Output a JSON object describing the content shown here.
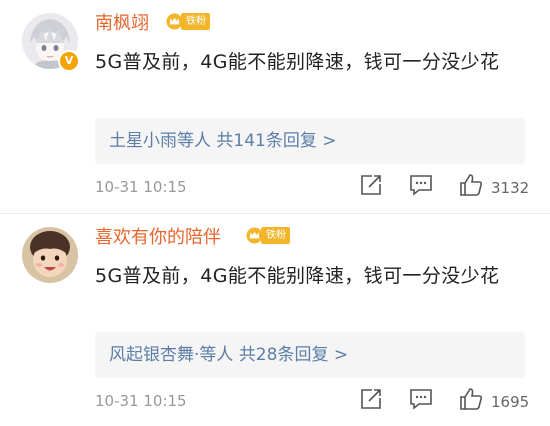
{
  "comments": [
    {
      "username": "南枫翊",
      "fan_badge": "铁粉",
      "verified_mark": "V",
      "text": "5G普及前，4G能不能别降速，钱可一分没少花",
      "replies": {
        "names": "土星小雨",
        "suffix": "等人",
        "count_text": "共141条回复",
        "arrow": ">"
      },
      "time": "10-31 10:15",
      "likes": "3132"
    },
    {
      "username": "喜欢有你的陪伴",
      "fan_badge": "铁粉",
      "text": "5G普及前，4G能不能别降速，钱可一分没少花",
      "replies": {
        "names": "风起银杏舞·",
        "suffix": "等人",
        "count_text": "共28条回复",
        "arrow": ">"
      },
      "time": "10-31 10:15",
      "likes": "1695"
    }
  ],
  "icons": {
    "share": "share-icon",
    "comment": "comment-icon",
    "like": "thumbs-up-icon",
    "badge": "crown-icon"
  },
  "colors": {
    "username": "#e8662b",
    "reply_link": "#5c7ea8",
    "fan_badge": "#f3b62a",
    "meta": "#999999"
  }
}
